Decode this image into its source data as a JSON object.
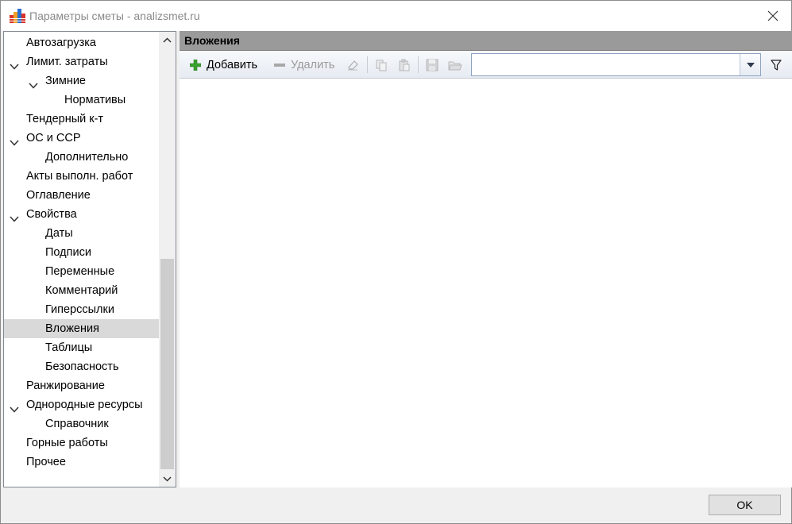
{
  "window": {
    "title": "Параметры сметы - analizsmet.ru"
  },
  "tree": {
    "items": [
      {
        "label": "Автозагрузка",
        "level": 0,
        "expander": false
      },
      {
        "label": "Лимит. затраты",
        "level": 0,
        "expander": true
      },
      {
        "label": "Зимние",
        "level": 1,
        "expander": true
      },
      {
        "label": "Нормативы",
        "level": 2,
        "expander": false
      },
      {
        "label": "Тендерный к-т",
        "level": 0,
        "expander": false
      },
      {
        "label": "ОС и ССР",
        "level": 0,
        "expander": true
      },
      {
        "label": "Дополнительно",
        "level": 1,
        "expander": false
      },
      {
        "label": "Акты выполн. работ",
        "level": 0,
        "expander": false
      },
      {
        "label": "Оглавление",
        "level": 0,
        "expander": false
      },
      {
        "label": "Свойства",
        "level": 0,
        "expander": true
      },
      {
        "label": "Даты",
        "level": 1,
        "expander": false
      },
      {
        "label": "Подписи",
        "level": 1,
        "expander": false
      },
      {
        "label": "Переменные",
        "level": 1,
        "expander": false
      },
      {
        "label": "Комментарий",
        "level": 1,
        "expander": false
      },
      {
        "label": "Гиперссылки",
        "level": 1,
        "expander": false
      },
      {
        "label": "Вложения",
        "level": 1,
        "expander": false,
        "selected": true
      },
      {
        "label": "Таблицы",
        "level": 1,
        "expander": false
      },
      {
        "label": "Безопасность",
        "level": 1,
        "expander": false
      },
      {
        "label": "Ранжирование",
        "level": 0,
        "expander": false
      },
      {
        "label": "Однородные ресурсы",
        "level": 0,
        "expander": true
      },
      {
        "label": "Справочник",
        "level": 1,
        "expander": false
      },
      {
        "label": "Горные работы",
        "level": 0,
        "expander": false
      },
      {
        "label": "Прочее",
        "level": 0,
        "expander": false
      }
    ]
  },
  "section": {
    "title": "Вложения"
  },
  "toolbar": {
    "add_label": "Добавить",
    "delete_label": "Удалить",
    "combo_value": ""
  },
  "footer": {
    "ok_label": "OK"
  },
  "colors": {
    "header_bg": "#9a9a9a",
    "selected_bg": "#d9d9d9",
    "add_icon": "#3aa02e"
  }
}
